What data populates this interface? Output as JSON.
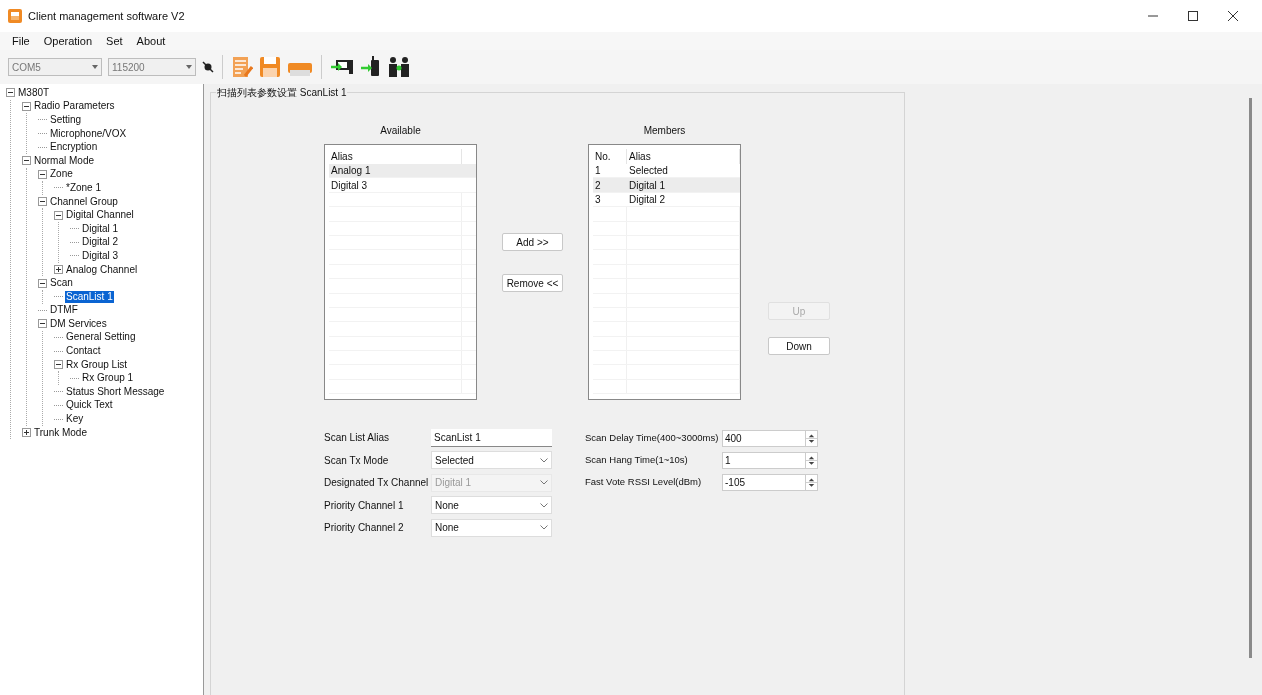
{
  "window": {
    "title": "Client management software V2"
  },
  "menu": [
    "File",
    "Operation",
    "Set",
    "About"
  ],
  "toolbar": {
    "port": "COM5",
    "baud": "115200"
  },
  "tree": [
    {
      "label": "M380T",
      "expanded": true,
      "selected": false,
      "children": [
        {
          "label": "Radio Parameters",
          "expanded": true,
          "selected": false,
          "children": [
            {
              "label": "Setting",
              "selected": false
            },
            {
              "label": "Microphone/VOX",
              "selected": false
            },
            {
              "label": "Encryption",
              "selected": false
            }
          ]
        },
        {
          "label": "Normal Mode",
          "expanded": true,
          "selected": false,
          "children": [
            {
              "label": "Zone",
              "expanded": true,
              "selected": false,
              "children": [
                {
                  "label": "*Zone 1",
                  "selected": false
                }
              ]
            },
            {
              "label": "Channel Group",
              "expanded": true,
              "selected": false,
              "children": [
                {
                  "label": "Digital Channel",
                  "expanded": true,
                  "selected": false,
                  "children": [
                    {
                      "label": "Digital 1",
                      "selected": false
                    },
                    {
                      "label": "Digital 2",
                      "selected": false
                    },
                    {
                      "label": "Digital 3",
                      "selected": false
                    }
                  ]
                },
                {
                  "label": "Analog Channel",
                  "expanded": false,
                  "selected": false
                }
              ]
            },
            {
              "label": "Scan",
              "expanded": true,
              "selected": false,
              "children": [
                {
                  "label": "ScanList 1",
                  "selected": true
                }
              ]
            },
            {
              "label": "DTMF",
              "selected": false
            },
            {
              "label": "DM Services",
              "expanded": true,
              "selected": false,
              "children": [
                {
                  "label": "General Setting",
                  "selected": false
                },
                {
                  "label": "Contact",
                  "selected": false
                },
                {
                  "label": "Rx Group List",
                  "expanded": true,
                  "selected": false,
                  "children": [
                    {
                      "label": "Rx Group 1",
                      "selected": false
                    }
                  ]
                },
                {
                  "label": "Status Short Message",
                  "selected": false
                },
                {
                  "label": "Quick Text",
                  "selected": false
                },
                {
                  "label": "Key",
                  "selected": false
                }
              ]
            }
          ]
        },
        {
          "label": "Trunk Mode",
          "expanded": false,
          "selected": false
        }
      ]
    }
  ],
  "panel": {
    "title": "扫描列表参数设置 ScanList 1",
    "available": {
      "heading": "Available",
      "columns": [
        "Alias"
      ],
      "rows": [
        {
          "alias": "Analog 1",
          "selected": true
        },
        {
          "alias": "Digital 3",
          "selected": false
        }
      ]
    },
    "members": {
      "heading": "Members",
      "columns": [
        "No.",
        "Alias"
      ],
      "rows": [
        {
          "no": "1",
          "alias": "Selected",
          "selected": false
        },
        {
          "no": "2",
          "alias": "Digital 1",
          "selected": true
        },
        {
          "no": "3",
          "alias": "Digital 2",
          "selected": false
        }
      ]
    },
    "transfer_buttons": [
      {
        "label": "Add >>",
        "disabled": false
      },
      {
        "label": "Remove <<",
        "disabled": false
      }
    ],
    "order_buttons": [
      {
        "label": "Up",
        "disabled": true
      },
      {
        "label": "Down",
        "disabled": false
      }
    ],
    "fields": [
      {
        "kind": "text",
        "label": "Scan List Alias",
        "value": "ScanList 1",
        "disabled": false
      },
      {
        "kind": "combo",
        "label": "Scan Tx Mode",
        "value": "Selected",
        "disabled": false
      },
      {
        "kind": "combo",
        "label": "Designated Tx Channel",
        "value": "Digital 1",
        "disabled": true
      },
      {
        "kind": "combo",
        "label": "Priority Channel 1",
        "value": "None",
        "disabled": false
      },
      {
        "kind": "combo",
        "label": "Priority Channel 2",
        "value": "None",
        "disabled": false
      }
    ],
    "spinners": [
      {
        "label": "Scan Delay Time(400~3000ms)",
        "value": "400"
      },
      {
        "label": "Scan Hang Time(1~10s)",
        "value": "1"
      },
      {
        "label": "Fast Vote RSSI Level(dBm)",
        "value": "-105"
      }
    ]
  }
}
